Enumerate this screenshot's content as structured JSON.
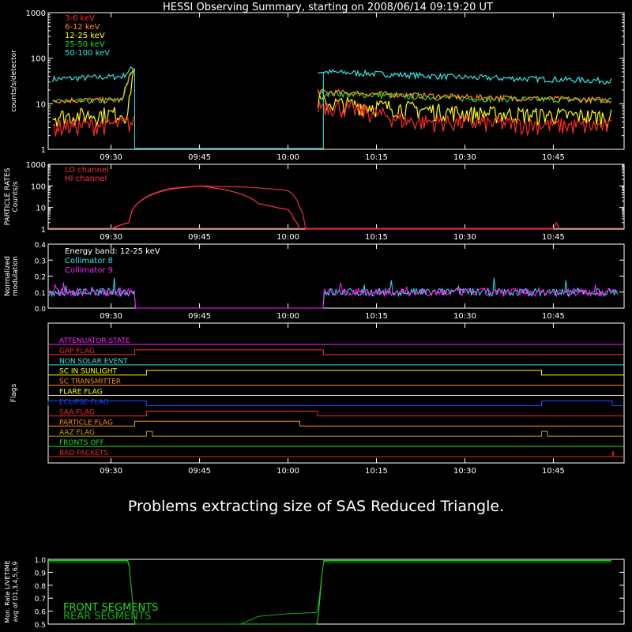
{
  "title": "HESSI Observing Summary, starting on 2008/06/14 09:19:20 UT",
  "message": "Problems extracting size of SAS Reduced Triangle.",
  "colors": {
    "red": "#ff2a2a",
    "orange": "#ff8c1a",
    "yellow": "#ffff00",
    "green": "#22dd22",
    "cyan": "#33e5e5",
    "magenta": "#ff22ff",
    "blue": "#2244ff",
    "olive": "#c8a000",
    "darkred": "#e0301c",
    "darkgreen": "#14b014",
    "axis": "#ffffff"
  },
  "chart_data": [
    {
      "id": "count-rates",
      "type": "line",
      "ylabel": "counts/s/detector",
      "yscale": "log",
      "ylim": [
        1,
        1000
      ],
      "yticks": [
        "1",
        "10",
        "100",
        "1000"
      ],
      "xticks": [
        "09:30",
        "09:45",
        "10:00",
        "10:15",
        "10:30",
        "10:45"
      ],
      "x_minutes_range": [
        "09:19:20",
        "10:55"
      ],
      "gaps": [
        [
          "09:34",
          "10:05"
        ]
      ],
      "series": [
        {
          "name": "3-6 keV",
          "color": "red",
          "points": [
            [
              "09:20",
              3
            ],
            [
              "09:33",
              3.5
            ],
            [
              "10:06",
              9
            ],
            [
              "10:20",
              4
            ],
            [
              "10:55",
              3
            ]
          ]
        },
        {
          "name": "6-12 keV",
          "color": "orange",
          "points": [
            [
              "09:20",
              12
            ],
            [
              "09:32",
              12
            ],
            [
              "09:34",
              60
            ],
            [
              "10:06",
              18
            ],
            [
              "10:30",
              14
            ],
            [
              "10:55",
              12
            ]
          ]
        },
        {
          "name": "12-25 keV",
          "color": "yellow",
          "points": [
            [
              "09:20",
              5
            ],
            [
              "09:33",
              6
            ],
            [
              "09:34",
              55
            ],
            [
              "10:06",
              10
            ],
            [
              "10:30",
              6
            ],
            [
              "10:55",
              5
            ]
          ]
        },
        {
          "name": "25-50 keV",
          "color": "green",
          "points": [
            [
              "09:20",
              11
            ],
            [
              "09:32",
              12
            ],
            [
              "09:34",
              60
            ],
            [
              "10:06",
              17
            ],
            [
              "10:30",
              13
            ],
            [
              "10:55",
              12
            ]
          ]
        },
        {
          "name": "50-100 keV",
          "color": "cyan",
          "points": [
            [
              "09:20",
              35
            ],
            [
              "09:32",
              40
            ],
            [
              "09:34",
              65
            ],
            [
              "10:06",
              50
            ],
            [
              "10:30",
              38
            ],
            [
              "10:55",
              32
            ]
          ]
        }
      ]
    },
    {
      "id": "particle-rates",
      "type": "line",
      "ylabel": "PARTICLE RATES Counts/s",
      "yscale": "log",
      "ylim": [
        1,
        1000
      ],
      "yticks": [
        "1",
        "10",
        "100",
        "1000"
      ],
      "xticks": [
        "09:30",
        "09:45",
        "10:00",
        "10:15",
        "10:30",
        "10:45"
      ],
      "series": [
        {
          "name": "LO channel",
          "color": "red",
          "points": [
            [
              "09:30",
              1
            ],
            [
              "09:33",
              2
            ],
            [
              "09:35",
              20
            ],
            [
              "09:40",
              70
            ],
            [
              "09:45",
              100
            ],
            [
              "09:52",
              90
            ],
            [
              "09:58",
              70
            ],
            [
              "10:00",
              60
            ],
            [
              "10:02",
              10
            ],
            [
              "10:03",
              1
            ],
            [
              "10:45",
              1
            ],
            [
              "10:45.5",
              2
            ],
            [
              "10:46",
              1
            ]
          ]
        },
        {
          "name": "HI channel",
          "color": "red",
          "points": [
            [
              "09:30",
              1
            ],
            [
              "09:33",
              2
            ],
            [
              "09:35",
              20
            ],
            [
              "09:40",
              75
            ],
            [
              "09:45",
              100
            ],
            [
              "09:50",
              60
            ],
            [
              "09:55",
              15
            ],
            [
              "09:58",
              10
            ],
            [
              "10:00",
              8
            ],
            [
              "10:01",
              3
            ],
            [
              "10:02",
              1
            ]
          ]
        }
      ]
    },
    {
      "id": "modulation",
      "type": "line",
      "ylabel": "Normalized modulation",
      "ylim": [
        0,
        0.4
      ],
      "yticks": [
        "0.0",
        "0.1",
        "0.2",
        "0.3",
        "0.4"
      ],
      "xticks": [
        "09:30",
        "09:45",
        "10:00",
        "10:15",
        "10:30",
        "10:45"
      ],
      "annotation": "Energy band: 12-25 keV",
      "gaps": [
        [
          "09:34",
          "10:06"
        ]
      ],
      "series": [
        {
          "name": "Collimator 8",
          "color": "cyan",
          "mean": 0.1
        },
        {
          "name": "Collimator 9",
          "color": "magenta",
          "mean": 0.1
        }
      ]
    },
    {
      "id": "flags",
      "type": "line",
      "ylabel": "Flags",
      "xticks": [
        "09:30",
        "09:45",
        "10:00",
        "10:15",
        "10:30",
        "10:45"
      ],
      "flags": [
        {
          "name": "ATTENUATOR STATE",
          "color": "magenta",
          "on": []
        },
        {
          "name": "GAP FLAG",
          "color": "red",
          "on": [
            [
              "09:34",
              "10:06"
            ]
          ]
        },
        {
          "name": "NON SOLAR EVENT",
          "color": "cyan",
          "on": []
        },
        {
          "name": "SC IN SUNLIGHT",
          "color": "yellow",
          "on": [
            [
              "09:36",
              "10:43"
            ]
          ]
        },
        {
          "name": "SC TRANSMITTER",
          "color": "orange",
          "on": []
        },
        {
          "name": "FLARE FLAG",
          "color": "yellow",
          "on": []
        },
        {
          "name": "ECLIPSE FLAG",
          "color": "blue",
          "on": [
            [
              "09:19:20",
              "09:36"
            ],
            [
              "10:43",
              "10:55"
            ]
          ]
        },
        {
          "name": "SAA FLAG",
          "color": "red",
          "on": [
            [
              "09:36",
              "10:05"
            ]
          ]
        },
        {
          "name": "PARTICLE FLAG",
          "color": "orange",
          "on": [
            [
              "09:34",
              "10:02"
            ]
          ]
        },
        {
          "name": "AAZ FLAG",
          "color": "olive",
          "on": [
            [
              "09:36",
              "09:37"
            ],
            [
              "10:43",
              "10:44"
            ]
          ]
        },
        {
          "name": "FRONTS OFF",
          "color": "green",
          "on": []
        },
        {
          "name": "BAD PACKETS",
          "color": "darkred",
          "on": [
            [
              "10:55",
              "10:55.2"
            ]
          ]
        }
      ]
    },
    {
      "id": "livetime",
      "type": "line",
      "ylabel": "Mon. Rate LIVETIME avg of D1,3,4,5,6,9",
      "ylim": [
        0.5,
        1.0
      ],
      "yticks": [
        "0.5",
        "0.6",
        "0.7",
        "0.8",
        "0.9",
        "1.0"
      ],
      "series": [
        {
          "name": "FRONT SEGMENTS",
          "color": "green",
          "points": [
            [
              "09:19:20",
              0.99
            ],
            [
              "09:33",
              0.99
            ],
            [
              "09:34",
              0.5
            ],
            [
              "10:05",
              0.5
            ],
            [
              "10:06",
              0.99
            ],
            [
              "10:55",
              0.99
            ]
          ]
        },
        {
          "name": "REAR SEGMENTS",
          "color": "darkgreen",
          "points": [
            [
              "09:19:20",
              0.98
            ],
            [
              "09:33",
              0.98
            ],
            [
              "09:34",
              0.5
            ],
            [
              "09:52",
              0.5
            ],
            [
              "09:55",
              0.56
            ],
            [
              "10:00",
              0.58
            ],
            [
              "10:05",
              0.59
            ],
            [
              "10:06",
              0.98
            ],
            [
              "10:55",
              0.98
            ]
          ]
        }
      ]
    }
  ]
}
